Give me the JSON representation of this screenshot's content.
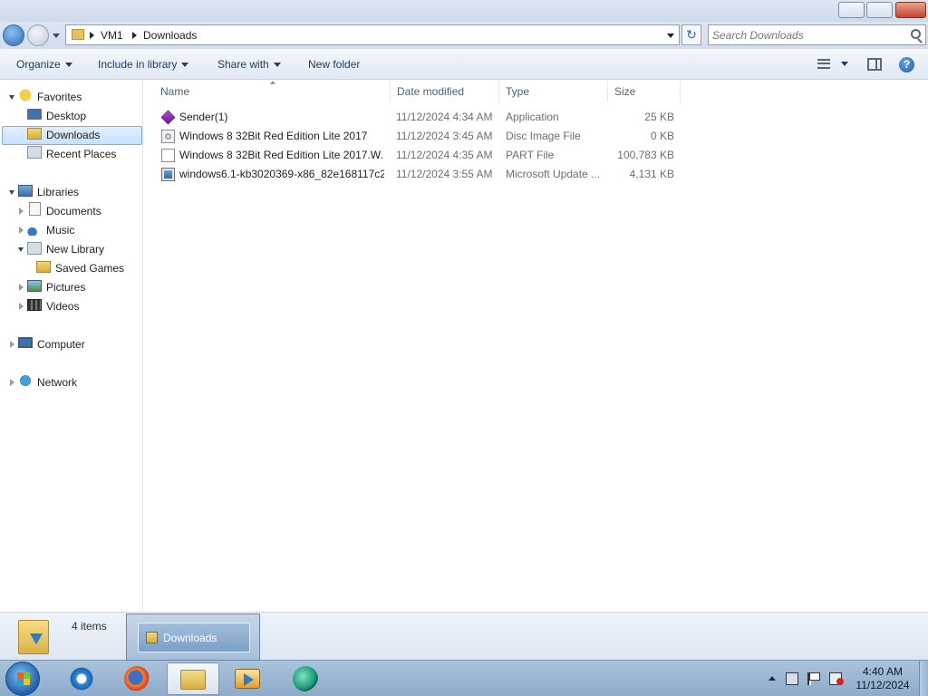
{
  "window": {
    "breadcrumb": [
      "VM1",
      "Downloads"
    ],
    "search_placeholder": "Search Downloads"
  },
  "commandbar": {
    "organize": "Organize",
    "include_in_library": "Include in library",
    "share_with": "Share with",
    "new_folder": "New folder"
  },
  "navpane": {
    "favorites": "Favorites",
    "desktop": "Desktop",
    "downloads": "Downloads",
    "recent_places": "Recent Places",
    "libraries": "Libraries",
    "documents": "Documents",
    "music": "Music",
    "new_library": "New Library",
    "saved_games": "Saved Games",
    "pictures": "Pictures",
    "videos": "Videos",
    "computer": "Computer",
    "network": "Network"
  },
  "columns": {
    "name": "Name",
    "date_modified": "Date modified",
    "type": "Type",
    "size": "Size"
  },
  "files": [
    {
      "name": "Sender(1)",
      "date": "11/12/2024 4:34 AM",
      "type": "Application",
      "size": "25 KB",
      "icon": "application-icon"
    },
    {
      "name": "Windows 8 32Bit Red Edition Lite 2017",
      "date": "11/12/2024 3:45 AM",
      "type": "Disc Image File",
      "size": "0 KB",
      "icon": "disc-image-icon"
    },
    {
      "name": "Windows 8 32Bit Red Edition Lite 2017.W...",
      "date": "11/12/2024 4:35 AM",
      "type": "PART File",
      "size": "100,783 KB",
      "icon": "file-icon"
    },
    {
      "name": "windows6.1-kb3020369-x86_82e168117c2...",
      "date": "11/12/2024 3:55 AM",
      "type": "Microsoft Update ...",
      "size": "4,131 KB",
      "icon": "update-package-icon"
    }
  ],
  "details": {
    "items_count": "4 items"
  },
  "taskbar": {
    "thumbnail_label": "Downloads",
    "clock_time": "4:40 AM",
    "clock_date": "11/12/2024"
  }
}
